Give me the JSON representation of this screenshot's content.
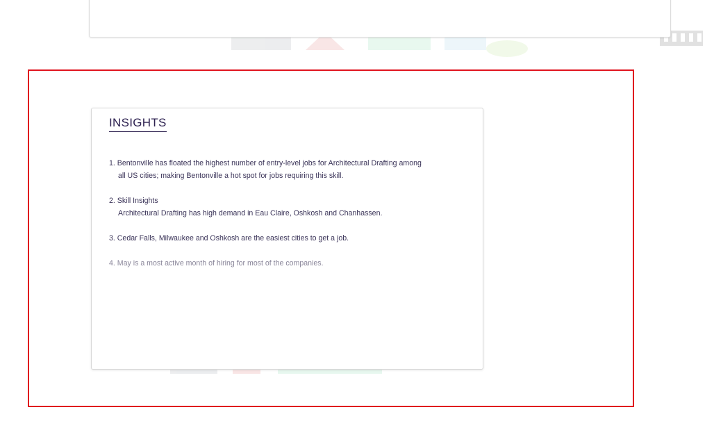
{
  "insights": {
    "title": "INSIGHTS",
    "items": [
      {
        "line1": "1. Bentonville has floated the highest number of entry-level jobs for Architectural Drafting among",
        "line2": "all US cities; making Bentonville a hot spot for jobs requiring this skill."
      },
      {
        "line1": "2. Skill Insights",
        "line2": "Architectural Drafting has high demand in Eau Claire, Oshkosh and Chanhassen."
      },
      {
        "line1": "3. Cedar Falls, Milwaukee and Oshkosh are the easiest cities to get a job."
      },
      {
        "line1": "4. May is a most active month of hiring for most of the companies."
      }
    ]
  },
  "colors": {
    "highlight_border": "#e0141e",
    "title_text": "#2d2150",
    "body_text": "#3a3358"
  }
}
